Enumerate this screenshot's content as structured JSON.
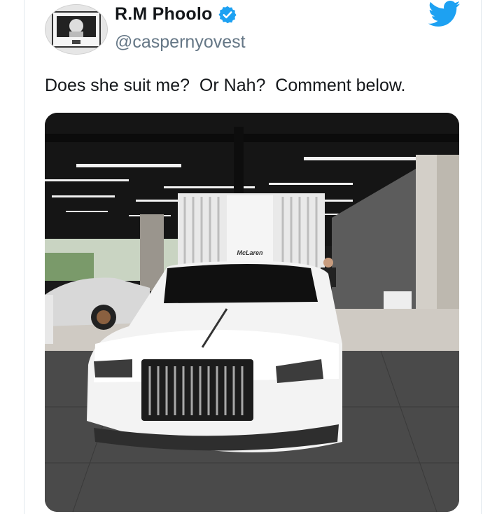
{
  "tweet": {
    "display_name": "R.M Phoolo",
    "handle": "@caspernyovest",
    "text": "Does she suit me?  Or Nah?  Comment below.",
    "verified": true,
    "brand_icon": "twitter-bird-icon",
    "accent_color": "#1da1f2"
  },
  "media": {
    "kind": "photo",
    "showroom_sign": "McLaren",
    "subject": "white Rolls-Royce in McLaren showroom"
  }
}
